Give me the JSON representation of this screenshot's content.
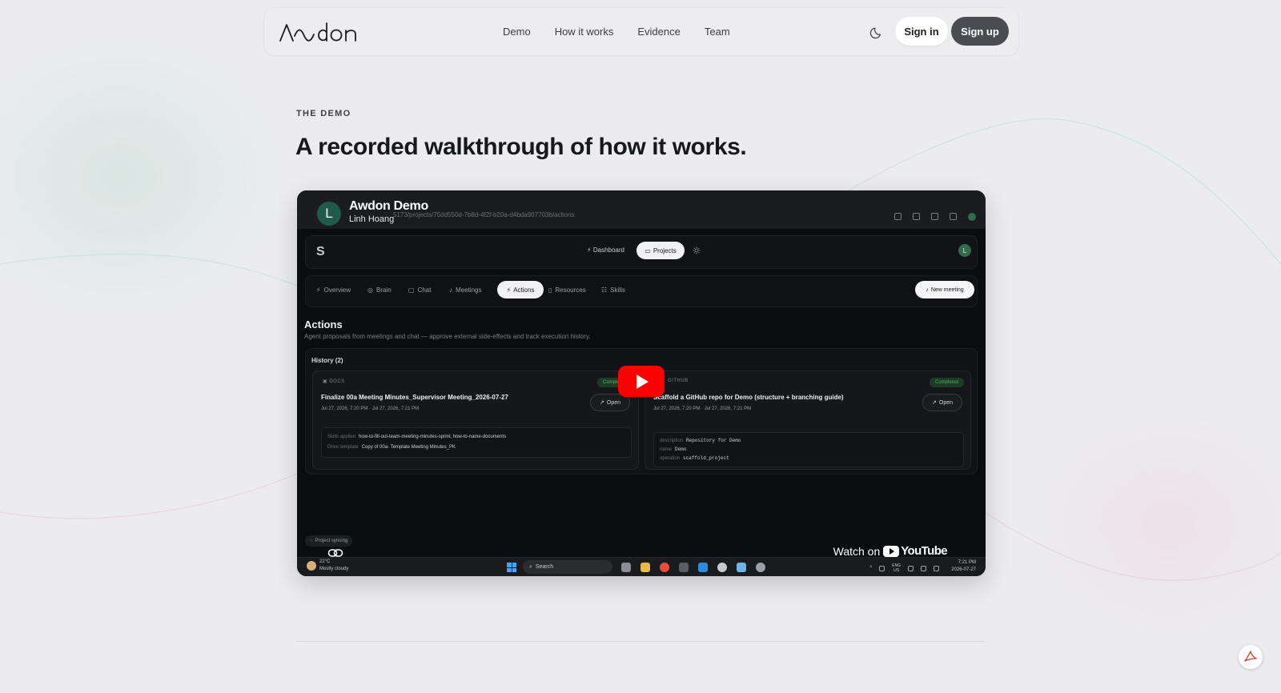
{
  "brand": {
    "logo_text": "Awdon"
  },
  "nav": {
    "links": [
      "Demo",
      "How it works",
      "Evidence",
      "Team"
    ],
    "sign_in": "Sign in",
    "sign_up": "Sign up"
  },
  "section": {
    "eyebrow": "THE DEMO",
    "title": "A recorded walkthrough of how it works."
  },
  "video": {
    "title": "Awdon Demo",
    "channel": "Linh Hoang",
    "channel_initial": "L",
    "url_fragment": "5173/projects/75dd550d-7b8d-4f2f-b20a-d4bda907703b/actions",
    "watch_on": "Watch on",
    "youtube": "YouTube",
    "app": {
      "dashboard": "Dashboard",
      "projects": "Projects",
      "avatar_initial": "L",
      "tabs": [
        "Overview",
        "Brain",
        "Chat",
        "Meetings",
        "Actions",
        "Resources",
        "Skills"
      ],
      "active_tab": "Actions",
      "new_meeting": "New meeting",
      "page_title": "Actions",
      "page_desc": "Agent proposals from meetings and chat — approve external side-effects and track execution history.",
      "history_label": "History (2)",
      "cards": [
        {
          "tag": "DOCS",
          "badge": "Completed",
          "title": "Finalize 00a Meeting Minutes_Supervisor Meeting_2026-07-27",
          "time": "Jul 27, 2026, 7:20 PM · Jul 27, 2026, 7:21 PM",
          "open": "Open",
          "rows": [
            {
              "k": "Skills applied",
              "v": "how-to-fill-out-team-meeting-minutes-sprint, how-to-name-documents"
            },
            {
              "k": "Drive template",
              "v": "Copy of 00a- Template Meeting Minutes_PK"
            }
          ]
        },
        {
          "tag": "GITHUB",
          "badge": "Completed",
          "title": "Scaffold a GitHub repo for Demo (structure + branching guide)",
          "time": "Jul 27, 2026, 7:20 PM · Jul 27, 2026, 7:21 PM",
          "open": "Open",
          "rows": [
            {
              "k": "description",
              "v": "Repository for Demo"
            },
            {
              "k": "name",
              "v": "Demo"
            },
            {
              "k": "operation",
              "v": "scaffold_project"
            }
          ]
        }
      ],
      "sync_status": "Project syncing"
    },
    "taskbar": {
      "temp": "22°C",
      "weather": "Mostly cloudy",
      "search": "Search",
      "lang_top": "ENG",
      "lang_bottom": "US",
      "time": "7:21 PM",
      "date": "2026-07-27"
    }
  }
}
